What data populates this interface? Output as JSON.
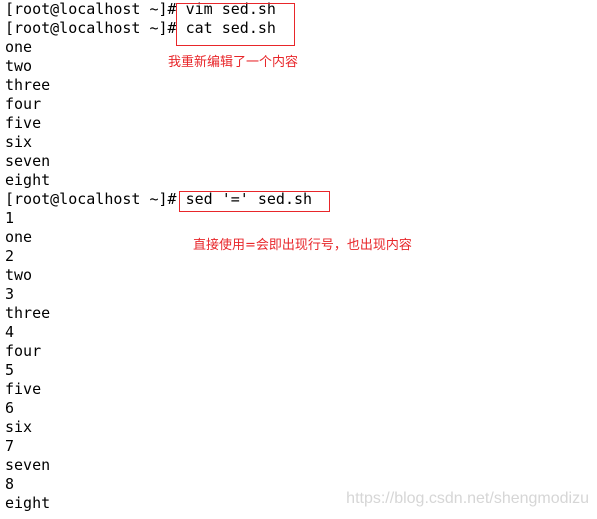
{
  "terminal": {
    "lines": [
      "[root@localhost ~]# vim sed.sh",
      "[root@localhost ~]# cat sed.sh",
      "one",
      "two",
      "three",
      "four",
      "five",
      "six",
      "seven",
      "eight",
      "[root@localhost ~]# sed '=' sed.sh",
      "1",
      "one",
      "2",
      "two",
      "3",
      "three",
      "4",
      "four",
      "5",
      "five",
      "6",
      "six",
      "7",
      "seven",
      "8",
      "eight"
    ]
  },
  "annotations": {
    "note1": "我重新编辑了一个内容",
    "note2": "直接使用=会即出现行号，也出现内容",
    "color": "#e8262a"
  },
  "watermark": "https://blog.csdn.net/shengmodizu"
}
